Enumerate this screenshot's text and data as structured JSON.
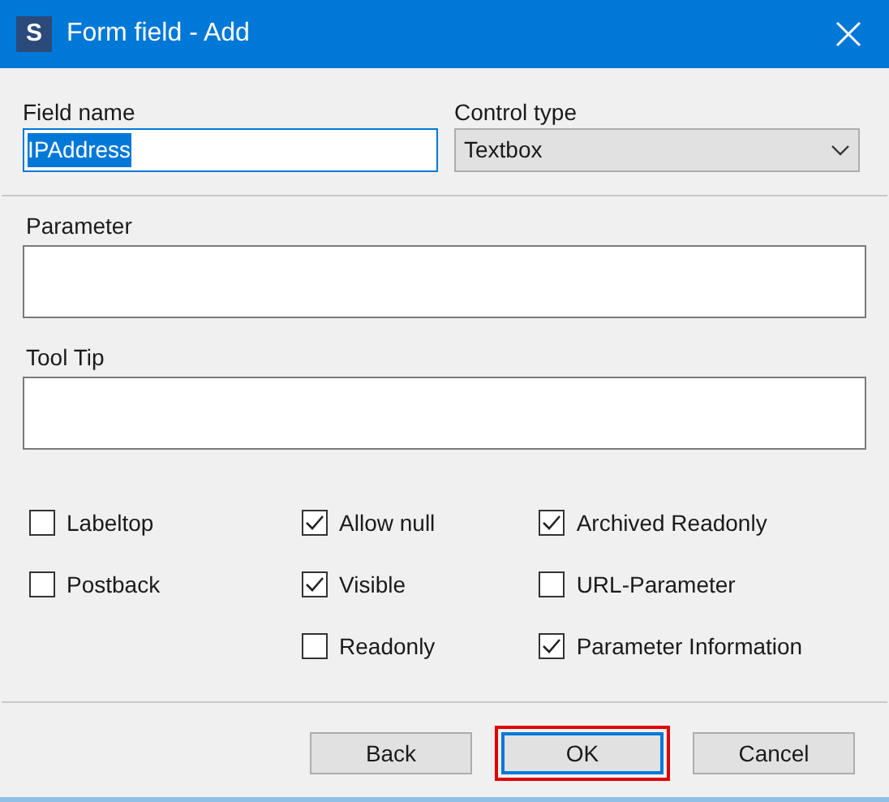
{
  "window": {
    "title": "Form field - Add",
    "app_icon_letter": "S"
  },
  "field_name": {
    "label": "Field name",
    "value": "IPAddress",
    "text_selected": true,
    "focused": true
  },
  "control_type": {
    "label": "Control type",
    "value": "Textbox"
  },
  "parameter": {
    "label": "Parameter"
  },
  "tool_tip": {
    "label": "Tool Tip"
  },
  "checkbox_columns": [
    [
      {
        "label": "Labeltop",
        "checked": false
      },
      {
        "label": "Postback",
        "checked": false
      }
    ],
    [
      {
        "label": "Allow null",
        "checked": true
      },
      {
        "label": "Visible",
        "checked": true
      },
      {
        "label": "Readonly",
        "checked": false
      }
    ],
    [
      {
        "label": "Archived Readonly",
        "checked": true
      },
      {
        "label": "URL-Parameter",
        "checked": false
      },
      {
        "label": "Parameter Information",
        "checked": true
      }
    ]
  ],
  "buttons": [
    {
      "label": "Back",
      "default": false,
      "highlighted": false
    },
    {
      "label": "OK",
      "default": true,
      "highlighted": true
    },
    {
      "label": "Cancel",
      "default": false,
      "highlighted": false
    }
  ]
}
